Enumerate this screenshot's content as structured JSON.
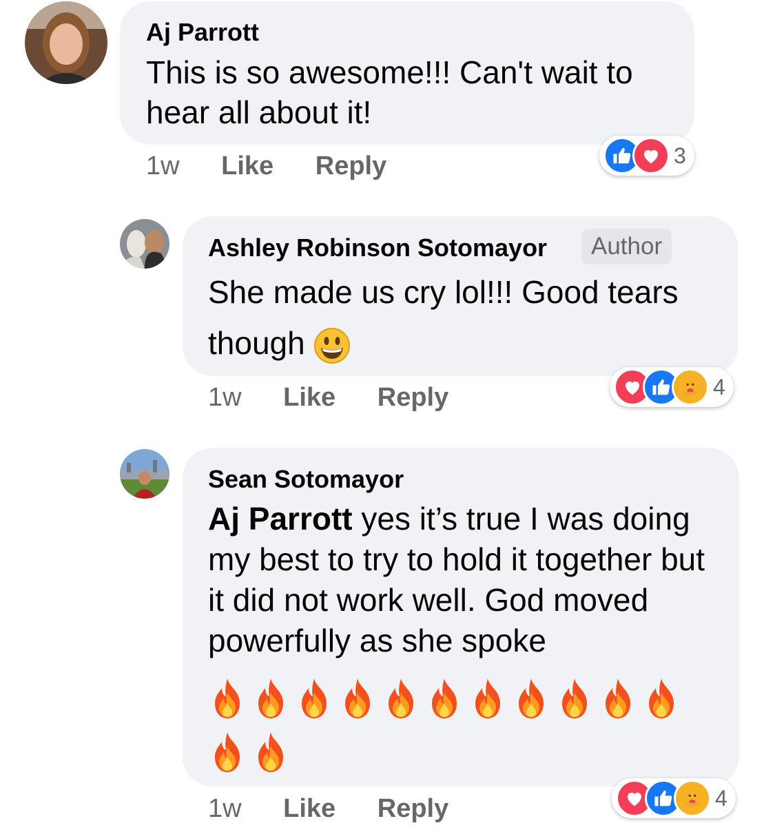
{
  "comments": [
    {
      "author": "Aj Parrott",
      "text": "This is so awesome!!!  Can't wait to hear all about it!",
      "time": "1w",
      "like_label": "Like",
      "reply_label": "Reply",
      "reaction_icons": [
        "like-icon",
        "love-icon"
      ],
      "reaction_count": "3"
    },
    {
      "author": "Ashley Robinson Sotomayor",
      "badge": "Author",
      "text": "She made us cry lol!!!  Good tears though",
      "emoji": "grinning-face-emoji",
      "time": "1w",
      "like_label": "Like",
      "reply_label": "Reply",
      "reaction_icons": [
        "love-icon",
        "like-icon",
        "care-icon"
      ],
      "reaction_count": "4"
    },
    {
      "author": "Sean Sotomayor",
      "mention": "Aj Parrott",
      "text": "yes it’s true I was doing my best to try to hold it together but it did not work well. God moved powerfully as she spoke",
      "emoji": "fire-emoji",
      "emoji_count": 13,
      "time": "1w",
      "like_label": "Like",
      "reply_label": "Reply",
      "reaction_icons": [
        "love-icon",
        "like-icon",
        "care-icon"
      ],
      "reaction_count": "4"
    }
  ],
  "colors": {
    "bubble": "#f0f2f5",
    "meta_text": "#65676b",
    "like_blue": "#1877f2",
    "love_red": "#f33e58",
    "care_yellow": "#f7b125"
  }
}
